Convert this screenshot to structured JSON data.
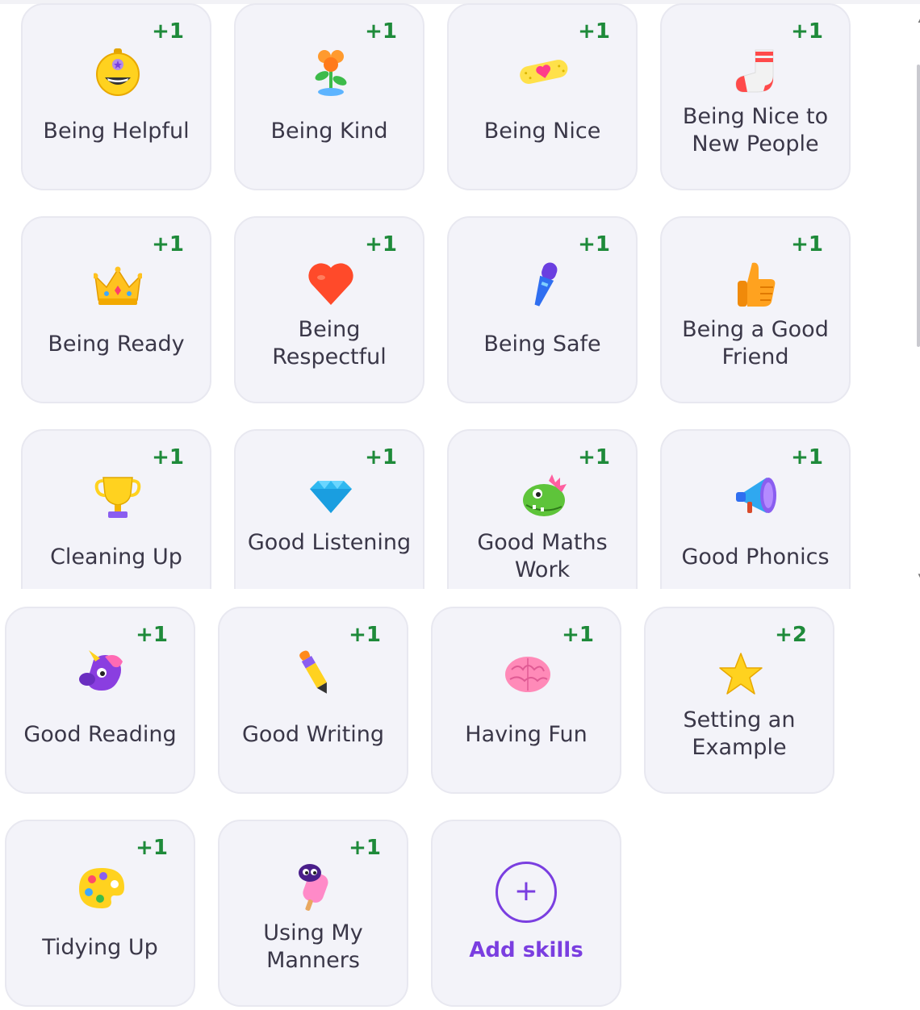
{
  "skills": [
    {
      "label": "Being Helpful",
      "points": "+1",
      "icon": "alarm-clock-smiley-icon"
    },
    {
      "label": "Being Kind",
      "points": "+1",
      "icon": "flower-icon"
    },
    {
      "label": "Being Nice",
      "points": "+1",
      "icon": "bandage-heart-icon"
    },
    {
      "label": "Being Nice to New People",
      "points": "+1",
      "icon": "sock-icon"
    },
    {
      "label": "Being Ready",
      "points": "+1",
      "icon": "crown-icon"
    },
    {
      "label": "Being Respectful",
      "points": "+1",
      "icon": "heart-icon"
    },
    {
      "label": "Being Safe",
      "points": "+1",
      "icon": "microphone-icon"
    },
    {
      "label": "Being a Good Friend",
      "points": "+1",
      "icon": "thumbs-up-icon"
    },
    {
      "label": "Cleaning Up",
      "points": "+1",
      "icon": "trophy-icon"
    },
    {
      "label": "Good Listening",
      "points": "+1",
      "icon": "diamond-icon"
    },
    {
      "label": "Good Maths Work",
      "points": "+1",
      "icon": "dinosaur-icon"
    },
    {
      "label": "Good Phonics",
      "points": "+1",
      "icon": "megaphone-icon"
    },
    {
      "label": "Good Reading",
      "points": "+1",
      "icon": "unicorn-icon"
    },
    {
      "label": "Good Writing",
      "points": "+1",
      "icon": "pencil-icon"
    },
    {
      "label": "Having Fun",
      "points": "+1",
      "icon": "brain-icon"
    },
    {
      "label": "Setting an Example",
      "points": "+2",
      "icon": "star-icon"
    },
    {
      "label": "Tidying Up",
      "points": "+1",
      "icon": "paint-palette-icon"
    },
    {
      "label": "Using My Manners",
      "points": "+1",
      "icon": "ice-lolly-icon"
    }
  ],
  "add_skill": {
    "label": "Add skills",
    "icon": "plus-circle-icon",
    "symbol": "+"
  },
  "colors": {
    "points": "#1e8a3a",
    "accent": "#7a3ee0",
    "card_bg": "#f3f3f9",
    "text": "#3a3748"
  }
}
